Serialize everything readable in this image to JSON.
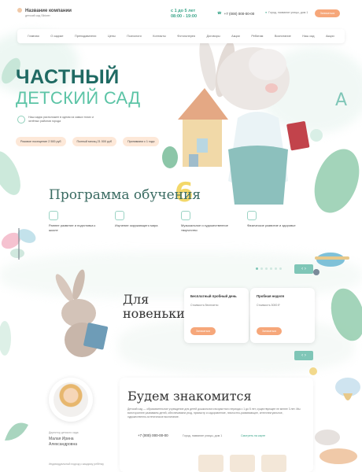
{
  "header": {
    "brand": "Название компании",
    "brand_sub": "детский сад Sibiwer",
    "hours_line1": "с 1 до 5 лет",
    "hours_line2": "08:00 - 19:00",
    "phone": "+7 (000) 000-00-00",
    "address": "Город, название улицы, дом 1",
    "cta": "Записаться"
  },
  "nav": [
    "Главная",
    "О садике",
    "Преподаватели",
    "Цены",
    "Психологи",
    "Контакты",
    "Фотогалерея",
    "Договоры",
    "Акции",
    "Ребятам",
    "Воспитание",
    "Наш сад",
    "Акции"
  ],
  "hero": {
    "title": "ЧАСТНЫЙ",
    "subtitle": "ДЕТСКИЙ САД",
    "note": "Наш садик расположен в одном из самых тихих и зелёных районов города",
    "pills": [
      "Разовое посещение 2 500 руб",
      "Полный месяц 21 000 руб",
      "Принимаем с 1 года"
    ]
  },
  "program": {
    "title": "Программа обучения",
    "cards": [
      "Раннее развитие и подготовка к школе",
      "Изучение окружающего мира",
      "Музыкальное и художественное творчество",
      "Физическое развитие и здоровье"
    ]
  },
  "newcomers": {
    "title_line1": "Для",
    "title_line2": "новеньких",
    "cards": [
      {
        "title": "Бесплатный пробный день",
        "price": "Стоимость бесплатно",
        "button": "Записаться"
      },
      {
        "title": "Пробная неделя",
        "price": "Стоимость 3000 ₽",
        "button": "Записаться"
      }
    ]
  },
  "meet": {
    "title": "Будем знакомится",
    "text": "Детский сад — образовательное учреждение для детей дошкольного возрастного периода с 1 до 5 лет, существующее не менее 3 лет. Мы всестороннее развиваем детей, обеспечиваем уход, присмотр и оздоровление, личностно-развивающее, интеллектуальное, художественно-эстетическое воспитание.",
    "phone": "+7 (000) 000-00-00",
    "address": "Город, название улицы, дом 1",
    "link": "Смотреть на карте",
    "director_role": "Директор детского сада",
    "director_name": "Малая Ирина Александровна",
    "footer": "Индивидуальный подход к каждому ребёнку"
  },
  "colors": {
    "accent": "#f6a77a",
    "brand": "#1f6a63",
    "mint": "#5cc4a6"
  }
}
